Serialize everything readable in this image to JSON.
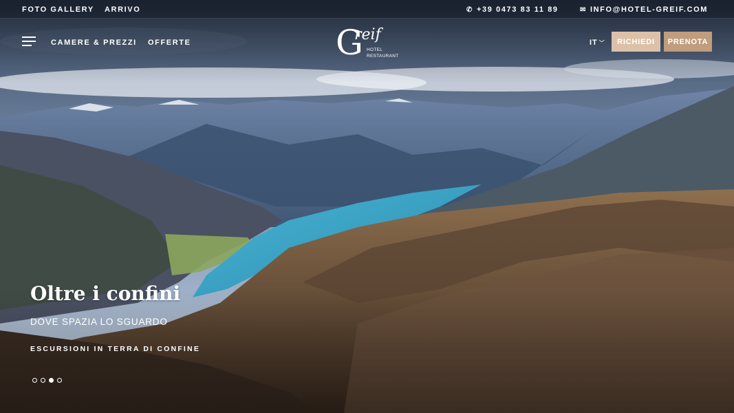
{
  "topbar": {
    "links": [
      "FOTO GALLERY",
      "ARRIVO"
    ],
    "phone": "+39 0473 83 11 89",
    "email": "INFO@HOTEL-GREIF.COM"
  },
  "icons": {
    "phone": "phone-icon",
    "email": "envelope-icon",
    "menu": "hamburger-menu-icon",
    "lang": "chevron-down-icon"
  },
  "nav": {
    "items": [
      "CAMERE & PREZZI",
      "OFFERTE"
    ]
  },
  "logo": {
    "letter": "G",
    "word": "reif",
    "line1": "HOTEL",
    "line2": "RESTAURANT"
  },
  "lang": "IT",
  "buttons": {
    "request": "RICHIEDI",
    "book": "PRENOTA"
  },
  "hero": {
    "title": "Oltre i confini",
    "subtitle": "DOVE SPAZIA LO SGUARDO",
    "cta": "ESCURSIONI IN TERRA DI CONFINE",
    "slides_total": 4,
    "active_slide": 3
  },
  "colors": {
    "request_btn": "#dcc1a8",
    "book_btn": "#c09d7d",
    "lake": "#3aa8c8"
  }
}
